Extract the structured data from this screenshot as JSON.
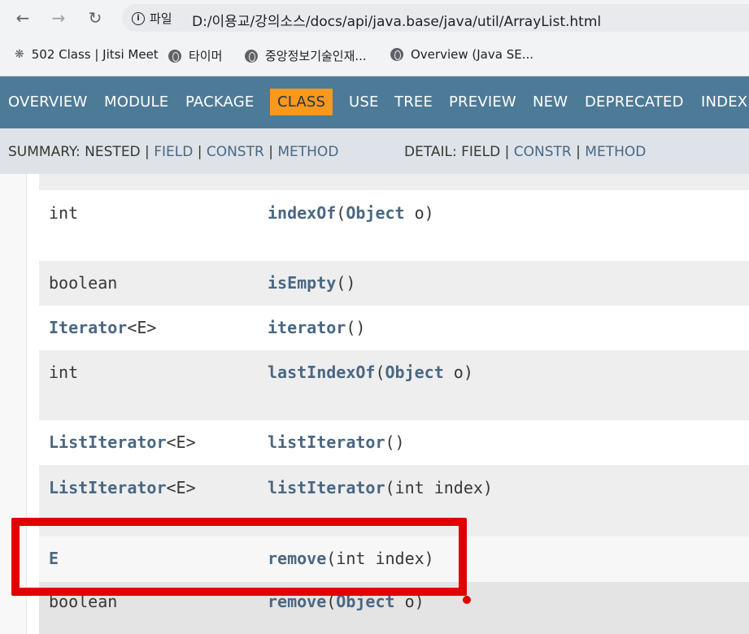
{
  "browser": {
    "site_info_label": "파일",
    "url": "D:/이용교/강의소스/docs/api/java.base/java/util/ArrayList.html",
    "bookmarks": [
      {
        "label": "502 Class | Jitsi Meet",
        "icon": "jitsi-icon"
      },
      {
        "label": "타이머",
        "icon": "globe-icon"
      },
      {
        "label": "중앙정보기술인재...",
        "icon": "globe-icon"
      },
      {
        "label": "Overview (Java SE...",
        "icon": "globe-icon"
      }
    ]
  },
  "topnav": {
    "items": [
      "OVERVIEW",
      "MODULE",
      "PACKAGE",
      "CLASS",
      "USE",
      "TREE",
      "PREVIEW",
      "NEW",
      "DEPRECATED",
      "INDEX"
    ],
    "active": "CLASS",
    "colors": {
      "bg": "#4D7A97",
      "active_bg": "#F8981D"
    }
  },
  "subnav": {
    "summary_prefix": "SUMMARY: NESTED |",
    "summary_links": [
      "FIELD",
      "CONSTR",
      "METHOD"
    ],
    "detail_prefix": "DETAIL: FIELD |",
    "detail_links": [
      "CONSTR",
      "METHOD"
    ],
    "sep": "|"
  },
  "methods": [
    {
      "type": "int",
      "type_linked": false,
      "name": "indexOf",
      "params_open": "(",
      "param_link": "Object",
      "params_rest": " o)"
    },
    {
      "type": "boolean",
      "type_linked": false,
      "name": "isEmpty",
      "params_open": "()",
      "param_link": "",
      "params_rest": ""
    },
    {
      "type_link": "Iterator",
      "type_rest": "<E>",
      "name": "iterator",
      "params_open": "()",
      "param_link": "",
      "params_rest": ""
    },
    {
      "type": "int",
      "type_linked": false,
      "name": "lastIndexOf",
      "params_open": "(",
      "param_link": "Object",
      "params_rest": " o)"
    },
    {
      "type_link": "ListIterator",
      "type_rest": "<E>",
      "name": "listIterator",
      "params_open": "()",
      "param_link": "",
      "params_rest": ""
    },
    {
      "type_link": "ListIterator",
      "type_rest": "<E>",
      "name": "listIterator",
      "params_open": "(int index)",
      "param_link": "",
      "params_rest": ""
    },
    {
      "type": "E",
      "type_linked": true,
      "name": "remove",
      "params_open": "(int index)",
      "param_link": "",
      "params_rest": ""
    },
    {
      "type": "boolean",
      "type_linked": false,
      "name": "remove",
      "params_open": "(",
      "param_link": "Object",
      "params_rest": " o)"
    }
  ],
  "highlight": {
    "color": "#e10000"
  }
}
